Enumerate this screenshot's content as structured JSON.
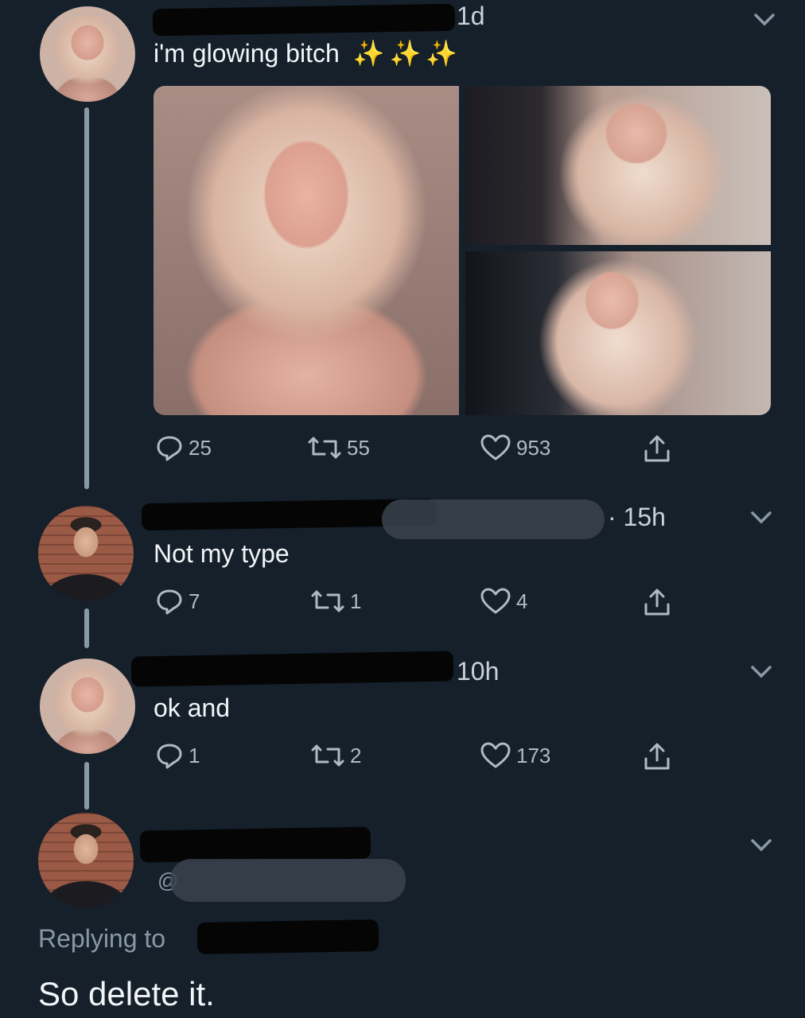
{
  "colors": {
    "background": "#15202b",
    "text": "#f2f5f7",
    "secondary": "#8899a6",
    "sparkle": "#f5c542"
  },
  "tweets": [
    {
      "time": "1d",
      "text": "i'm glowing bitch",
      "emoji": "✨✨✨",
      "replies": "25",
      "retweets": "55",
      "likes": "953"
    },
    {
      "time": "· 15h",
      "text": "Not my type",
      "replies": "7",
      "retweets": "1",
      "likes": "4"
    },
    {
      "time": "10h",
      "text": "ok and",
      "replies": "1",
      "retweets": "2",
      "likes": "173"
    },
    {
      "handle_prefix": "@",
      "replying_label": "Replying to",
      "text": "So delete it."
    }
  ]
}
